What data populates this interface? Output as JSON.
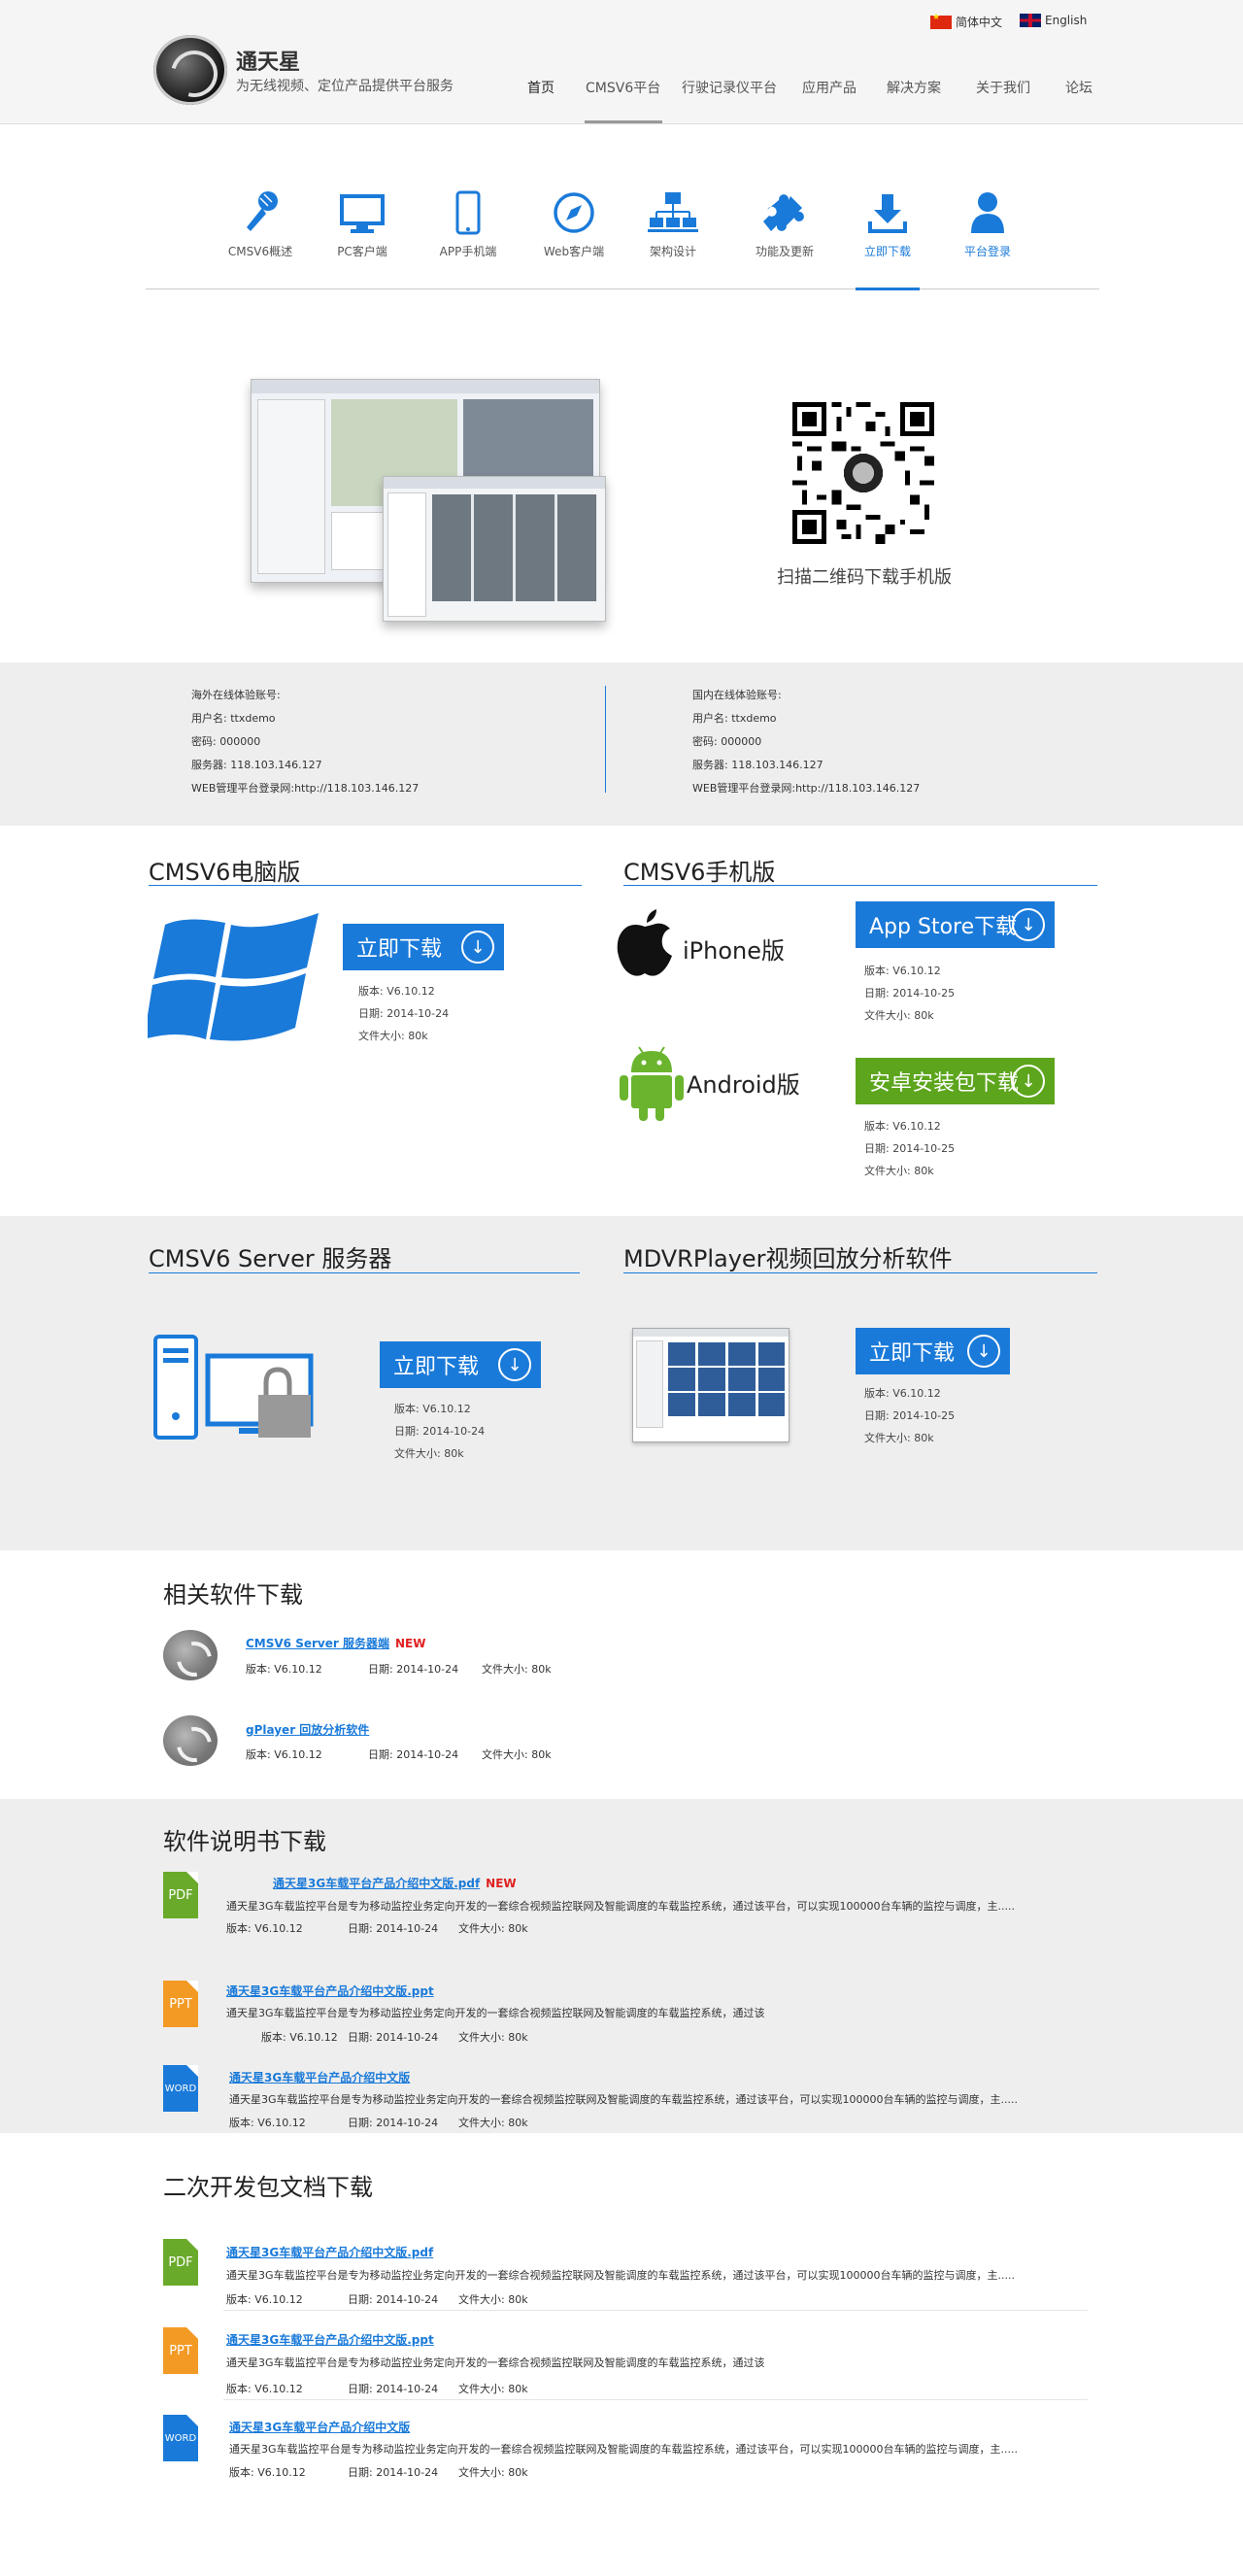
{
  "header": {
    "brand_name": "通天星",
    "brand_slogan": "为无线视频、定位产品提供平台服务",
    "lang_cn": "简体中文",
    "lang_en": "English",
    "nav": [
      "首页",
      "CMSV6平台",
      "行驶记录仪平台",
      "应用产品",
      "解决方案",
      "关于我们",
      "论坛"
    ]
  },
  "tabs": [
    {
      "label": "CMSV6概述",
      "icon": "microphone-icon"
    },
    {
      "label": "PC客户端",
      "icon": "monitor-icon"
    },
    {
      "label": "APP手机端",
      "icon": "phone-icon"
    },
    {
      "label": "Web客户端",
      "icon": "compass-icon"
    },
    {
      "label": "架构设计",
      "icon": "network-icon"
    },
    {
      "label": "功能及更新",
      "icon": "puzzle-icon"
    },
    {
      "label": "立即下载",
      "icon": "download-icon"
    },
    {
      "label": "平台登录",
      "icon": "user-icon"
    }
  ],
  "hero": {
    "qr_caption": "扫描二维码下载手机版"
  },
  "accounts": {
    "overseas": {
      "title": "海外在线体验账号:",
      "user": "用户名: ttxdemo",
      "password": "密码: 000000",
      "server": "服务器: 118.103.146.127",
      "web": "WEB管理平台登录网:http://118.103.146.127"
    },
    "domestic": {
      "title": "国内在线体验账号:",
      "user": "用户名: ttxdemo",
      "password": "密码: 000000",
      "server": "服务器: 118.103.146.127",
      "web": "WEB管理平台登录网:http://118.103.146.127"
    }
  },
  "pc": {
    "title": "CMSV6电脑版",
    "button": "立即下载",
    "version": "版本: V6.10.12",
    "date": "日期: 2014-10-24",
    "size": "文件大小: 80k"
  },
  "mobile": {
    "title": "CMSV6手机版",
    "iphone_label": "iPhone版",
    "iphone_button": "App Store下载",
    "iphone_version": "版本: V6.10.12",
    "iphone_date": "日期: 2014-10-25",
    "iphone_size": "文件大小: 80k",
    "android_label": "Android版",
    "android_button": "安卓安装包下载",
    "android_version": "版本: V6.10.12",
    "android_date": "日期: 2014-10-25",
    "android_size": "文件大小: 80k",
    "accent_green": "#5ca51c"
  },
  "server": {
    "title": "CMSV6 Server 服务器",
    "button": "立即下载",
    "version": "版本: V6.10.12",
    "date": "日期: 2014-10-24",
    "size": "文件大小: 80k"
  },
  "player": {
    "title": "MDVRPlayer视频回放分析软件",
    "button": "立即下载",
    "version": "版本: V6.10.12",
    "date": "日期: 2014-10-25",
    "size": "文件大小: 80k"
  },
  "related": {
    "title": "相关软件下载",
    "items": [
      {
        "name": "CMSV6 Server 服务器端",
        "new": "NEW",
        "version": "版本: V6.10.12",
        "date": "日期: 2014-10-24",
        "size": "文件大小: 80k"
      },
      {
        "name": "gPlayer 回放分析软件",
        "version": "版本: V6.10.12",
        "date": "日期: 2014-10-24",
        "size": "文件大小: 80k"
      }
    ]
  },
  "manuals": {
    "title": "软件说明书下载",
    "items": [
      {
        "type": "PDF",
        "name": "通天星3G车载平台产品介绍中文版.pdf",
        "new": "NEW",
        "desc": "通天星3G车载监控平台是专为移动监控业务定向开发的一套综合视频监控联网及智能调度的车载监控系统，通过该平台，可以实现100000台车辆的监控与调度，主.....",
        "version": "版本: V6.10.12",
        "date": "日期: 2014-10-24",
        "size": "文件大小: 80k"
      },
      {
        "type": "PPT",
        "name": "通天星3G车载平台产品介绍中文版.ppt",
        "desc": "通天星3G车载监控平台是专为移动监控业务定向开发的一套综合视频监控联网及智能调度的车载监控系统，通过该",
        "version": "版本: V6.10.12",
        "date": "日期: 2014-10-24",
        "size": "文件大小: 80k"
      },
      {
        "type": "WORD",
        "name": "通天星3G车载平台产品介绍中文版",
        "desc": "通天星3G车载监控平台是专为移动监控业务定向开发的一套综合视频监控联网及智能调度的车载监控系统，通过该平台，可以实现100000台车辆的监控与调度，主.....",
        "version": "版本: V6.10.12",
        "date": "日期: 2014-10-24",
        "size": "文件大小: 80k"
      }
    ]
  },
  "sdk": {
    "title": "二次开发包文档下载",
    "items": [
      {
        "type": "PDF",
        "name": "通天星3G车载平台产品介绍中文版.pdf",
        "desc": "通天星3G车载监控平台是专为移动监控业务定向开发的一套综合视频监控联网及智能调度的车载监控系统，通过该平台，可以实现100000台车辆的监控与调度，主.....",
        "version": "版本: V6.10.12",
        "date": "日期: 2014-10-24",
        "size": "文件大小: 80k"
      },
      {
        "type": "PPT",
        "name": "通天星3G车载平台产品介绍中文版.ppt",
        "desc": "通天星3G车载监控平台是专为移动监控业务定向开发的一套综合视频监控联网及智能调度的车载监控系统，通过该",
        "version": "版本: V6.10.12",
        "date": "日期: 2014-10-24",
        "size": "文件大小: 80k"
      },
      {
        "type": "WORD",
        "name": "通天星3G车载平台产品介绍中文版",
        "desc": "通天星3G车载监控平台是专为移动监控业务定向开发的一套综合视频监控联网及智能调度的车载监控系统，通过该平台，可以实现100000台车辆的监控与调度，主.....",
        "version": "版本: V6.10.12",
        "date": "日期: 2014-10-24",
        "size": "文件大小: 80k"
      }
    ]
  },
  "colors": {
    "accent": "#1a7ad9",
    "green": "#5ca51c",
    "orange": "#f39a25",
    "new": "#e02020"
  }
}
